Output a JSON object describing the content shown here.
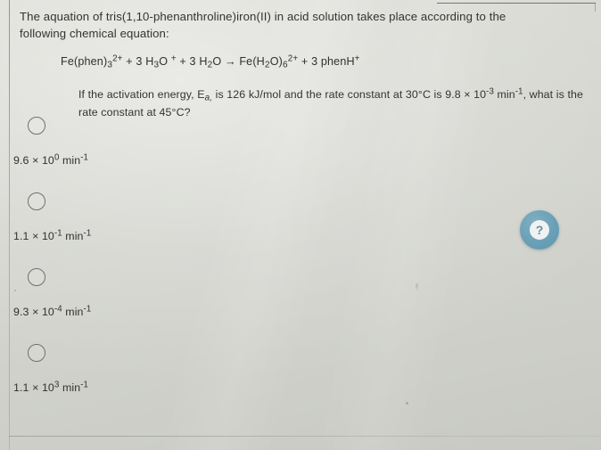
{
  "question": {
    "prompt_line1": "The aquation of tris(1,10-phenanthroline)iron(II) in acid solution takes place according to the",
    "prompt_line2": "following chemical equation:",
    "equation_parts": {
      "reactant1": "Fe(phen)",
      "reactant1_sub": "3",
      "reactant1_sup": "2+",
      "plus1": "+ 3 H",
      "reactant2_sub": "3",
      "reactant2": "O",
      "reactant2_sup": "+",
      "plus2": "+ 3 H",
      "reactant3_sub": "2",
      "reactant3": "O",
      "arrow": "→",
      "product1": "Fe(H",
      "product1_sub": "2",
      "product1_mid": "O)",
      "product1_sub2": "6",
      "product1_sup": "2+",
      "plus3": "+ 3 phenH",
      "product2_sup": "+"
    },
    "equation_plain": "Fe(phen)3 2+ + 3 H3O + + 3 H2O → Fe(H2O)6 2+ + 3 phenH +",
    "given_text_1": "If the activation energy, E",
    "given_sub_a": "a,",
    "given_text_2": " is 126 kJ/mol and the rate constant at 30°C is 9.8 × 10",
    "given_sup_1": "-3",
    "given_text_3": " min",
    "given_sup_2": "-1",
    "given_text_4": ", what is the rate constant at 45°C?"
  },
  "options": [
    {
      "id": "option-1",
      "selected": false,
      "coefficient": "9.6 × 10",
      "exponent": "0",
      "unit": "min",
      "unit_exponent": "-1",
      "plain": "9.6 × 10^0 min^-1"
    },
    {
      "id": "option-2",
      "selected": false,
      "coefficient": "1.1 × 10",
      "exponent": "-1",
      "unit": "min",
      "unit_exponent": "-1",
      "plain": "1.1 × 10^-1 min^-1"
    },
    {
      "id": "option-3",
      "selected": false,
      "coefficient": "9.3 × 10",
      "exponent": "-4",
      "unit": "min",
      "unit_exponent": "-1",
      "plain": "9.3 × 10^-4 min^-1"
    },
    {
      "id": "option-4",
      "selected": false,
      "coefficient": "1.1 × 10",
      "exponent": "3",
      "unit": "min",
      "unit_exponent": "-1",
      "plain": "1.1 × 10^3 min^-1"
    }
  ],
  "help": {
    "icon": "question-mark-icon",
    "label": "?",
    "color": "#6ca2b8"
  },
  "colors": {
    "page_background": "#d4d5cf",
    "text": "#32352f",
    "rule": "#6d706b",
    "help_accent": "#6ca2b8"
  }
}
